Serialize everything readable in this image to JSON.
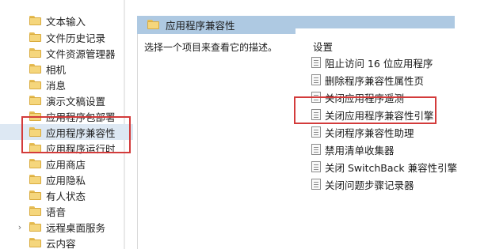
{
  "tree": {
    "items": [
      {
        "label": "文本输入",
        "expander": ""
      },
      {
        "label": "文件历史记录",
        "expander": ""
      },
      {
        "label": "文件资源管理器",
        "expander": ""
      },
      {
        "label": "相机",
        "expander": ""
      },
      {
        "label": "消息",
        "expander": ""
      },
      {
        "label": "演示文稿设置",
        "expander": ""
      },
      {
        "label": "应用程序包部署",
        "expander": ""
      },
      {
        "label": "应用程序兼容性",
        "expander": "",
        "selected": true
      },
      {
        "label": "应用程序运行时",
        "expander": ""
      },
      {
        "label": "应用商店",
        "expander": ""
      },
      {
        "label": "应用隐私",
        "expander": ""
      },
      {
        "label": "有人状态",
        "expander": ""
      },
      {
        "label": "语音",
        "expander": ""
      },
      {
        "label": "远程桌面服务",
        "expander": "›"
      },
      {
        "label": "云内容",
        "expander": ""
      }
    ]
  },
  "details": {
    "header_title": "应用程序兼容性",
    "description_hint": "选择一个项目来查看它的描述。",
    "settings_heading": "设置",
    "settings": [
      {
        "label": "阻止访问 16 位应用程序"
      },
      {
        "label": "删除程序兼容性属性页"
      },
      {
        "label": "关闭应用程序遥测"
      },
      {
        "label": "关闭应用程序兼容性引擎",
        "highlighted": true
      },
      {
        "label": "关闭程序兼容性助理"
      },
      {
        "label": "禁用清单收集器"
      },
      {
        "label": "关闭 SwitchBack 兼容性引擎"
      },
      {
        "label": "关闭问题步骤记录器"
      }
    ]
  },
  "colors": {
    "highlight": "#d33b3b",
    "selected_row": "#dde8f3",
    "header_bar": "#aec9e2",
    "folder": "#f5d67c"
  }
}
